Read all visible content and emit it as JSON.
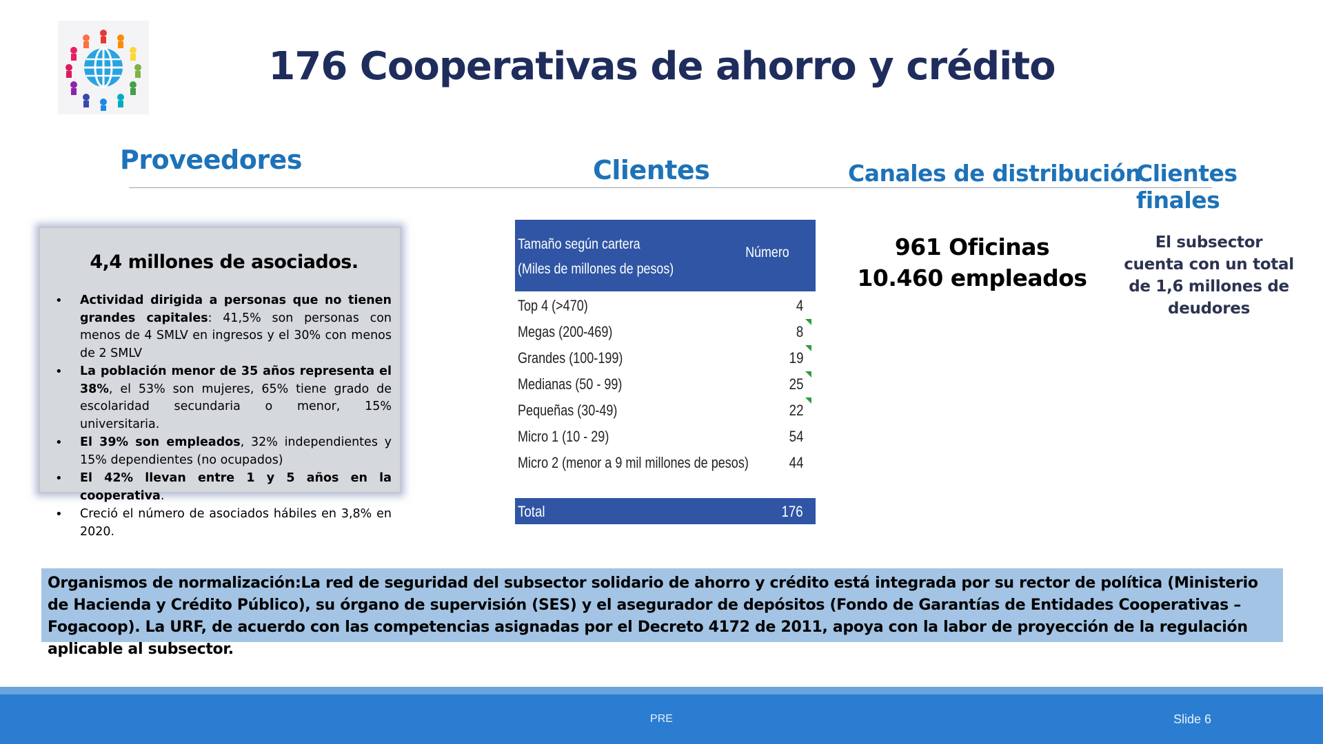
{
  "title": "176 Cooperativas de ahorro y crédito",
  "columns": {
    "proveedores": "Proveedores",
    "clientes": "Clientes",
    "canales": "Canales de distribución",
    "clientes_finales": "Clientes finales"
  },
  "proveedores_card": {
    "heading": "4,4 millones de asociados.",
    "items": [
      {
        "bold": "Actividad dirigida a personas que no tienen grandes capitales",
        "text": ": 41,5% son personas con menos de 4 SMLV en ingresos y el 30% con menos de 2 SMLV"
      },
      {
        "bold": "La población menor de 35 años representa el 38%",
        "text": ", el 53% son mujeres, 65% tiene grado de escolaridad secundaria o menor, 15% universitaria."
      },
      {
        "bold": "El 39% son empleados",
        "text": ", 32% independientes y 15% dependientes (no ocupados)"
      },
      {
        "bold": "El 42% llevan entre 1 y 5 años en la cooperativa",
        "text": "."
      },
      {
        "bold": "",
        "text": "Creció el número de asociados hábiles en 3,8% en 2020."
      }
    ]
  },
  "clientes_table": {
    "header_col1_line1": "Tamaño según cartera",
    "header_col1_line2": "(Miles de millones de pesos)",
    "header_col2": "Número",
    "rows": [
      {
        "label": "Top 4 (>470)",
        "value": "4"
      },
      {
        "label": "Megas (200-469)",
        "value": "8"
      },
      {
        "label": "Grandes (100-199)",
        "value": "19"
      },
      {
        "label": "Medianas (50 - 99)",
        "value": "25"
      },
      {
        "label": "Pequeñas (30-49)",
        "value": "22"
      },
      {
        "label": "Micro 1 (10 - 29)",
        "value": "54"
      },
      {
        "label": "Micro 2 (menor a 9 mil millones de pesos)",
        "value": "44"
      }
    ],
    "total_label": "Total",
    "total_value": "176"
  },
  "canales": {
    "line1": "961 Oficinas",
    "line2": "10.460 empleados"
  },
  "clientes_finales": {
    "text": "El subsector cuenta con un total de 1,6 millones de deudores"
  },
  "regulacion": {
    "text": "Organismos de normalización:La red de seguridad del subsector solidario de ahorro y crédito está integrada por su rector de política (Ministerio de Hacienda y Crédito Público), su órgano de supervisión (SES) y el asegurador de depósitos (Fondo de Garantías de Entidades Cooperativas – Fogacoop). La URF, de acuerdo con las competencias asignadas por el Decreto 4172 de 2011, apoya con la labor de proyección de la regulación aplicable al subsector."
  },
  "footer": {
    "center": "PRE",
    "slide": "Slide 6"
  },
  "colors": {
    "title": "#1f2d5c",
    "heading_blue": "#1d72b8",
    "table_header": "#2f55a4",
    "reg_box": "#a3c4e4",
    "footer": "#2a7dd1"
  },
  "icons": {
    "logo": "globe-people-logo"
  }
}
